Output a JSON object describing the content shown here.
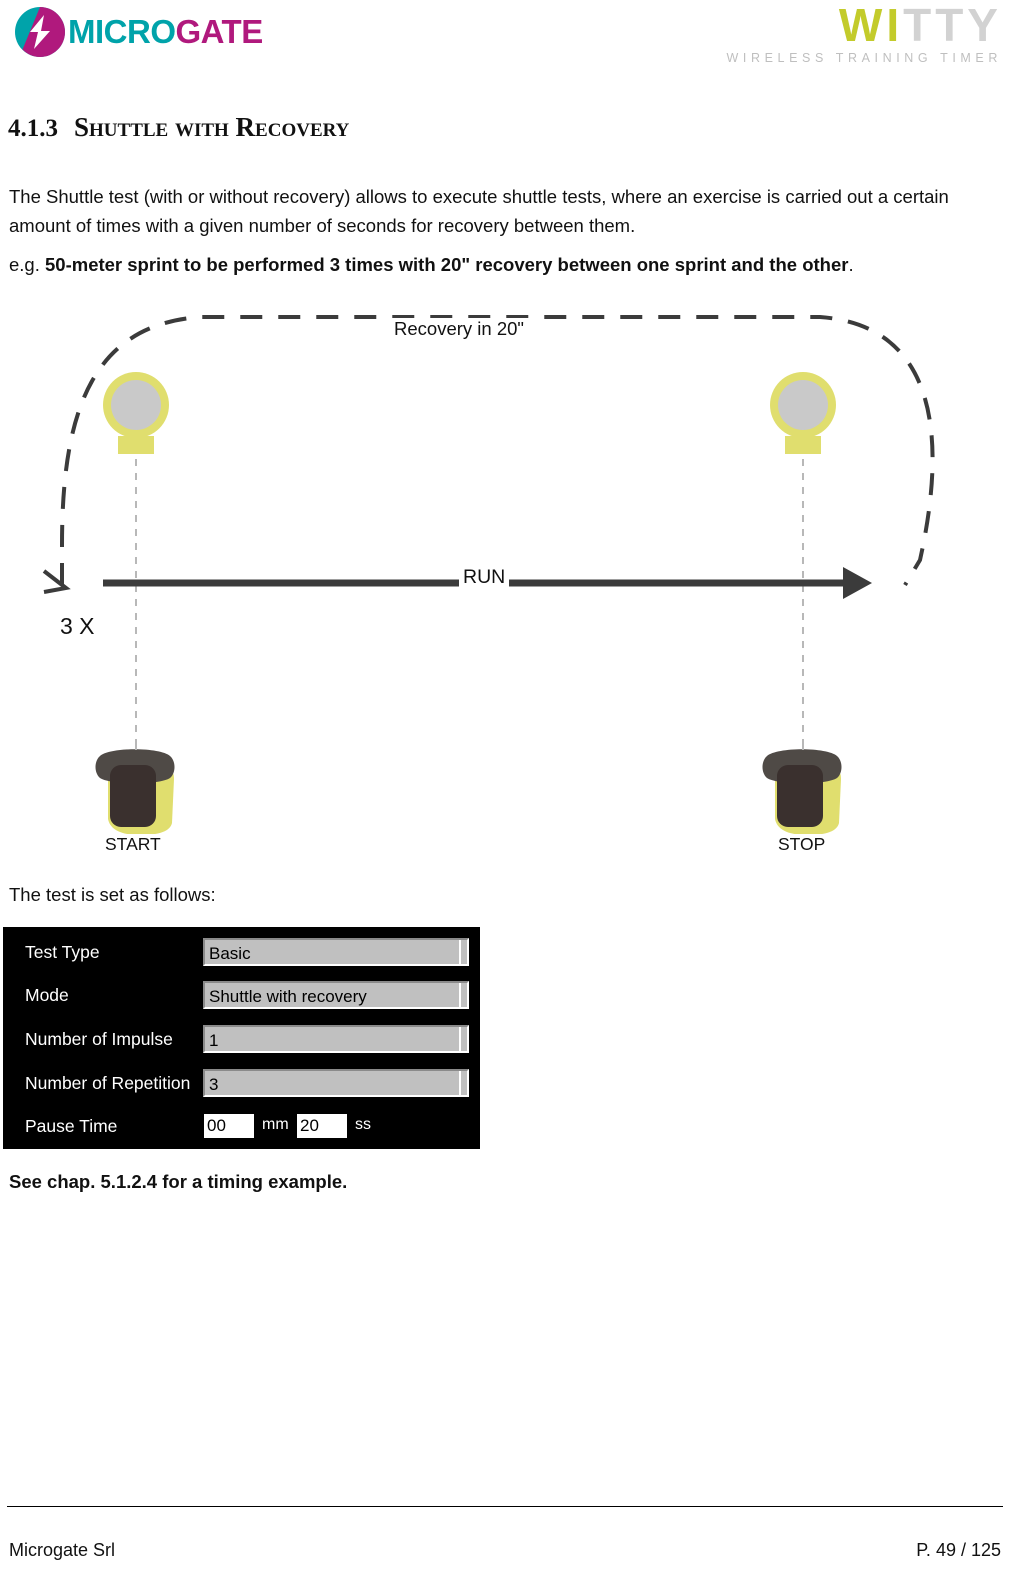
{
  "header": {
    "microgate_logo": {
      "text_part1": "MICRO",
      "text_part2": "GATE",
      "color_teal": "#00A3AA",
      "color_magenta": "#B0197D"
    },
    "witty_logo": {
      "text_part1": "WI",
      "text_part2": "TTY",
      "subtitle": "WIRELESS TRAINING TIMER",
      "color_yellow": "#C3CB2B",
      "color_gray": "#D2D2D2"
    }
  },
  "heading": {
    "number": "4.1.3",
    "title": "Shuttle with Recovery"
  },
  "body": {
    "intro": "The Shuttle test (with or without recovery) allows to execute shuttle tests, where an exercise is carried out a certain amount of times with a given number of seconds for recovery between them.",
    "example_prefix": "e.g. ",
    "example_bold": "50-meter sprint to be performed 3 times with 20\" recovery between one sprint and the other",
    "example_suffix": ".",
    "follows": "The test is set as follows:",
    "see_chapter": "See chap. 5.1.2.4 for a timing example."
  },
  "diagram": {
    "recovery_label": "Recovery in 20\"",
    "run_label": "RUN",
    "repetitions_label": "3 X",
    "start_label": "START",
    "stop_label": "STOP",
    "colors": {
      "device_yellow": "#E0DE6E",
      "device_dark": "#3A302E",
      "device_cap": "#4F4A46",
      "line_dark": "#3B3B3B"
    }
  },
  "settings_panel": {
    "background": "#000000",
    "rows": [
      {
        "label": "Test Type",
        "type": "combo",
        "value": "Basic"
      },
      {
        "label": "Mode",
        "type": "combo",
        "value": "Shuttle with recovery"
      },
      {
        "label": "Number of Impulse",
        "type": "combo",
        "value": "1"
      },
      {
        "label": "Number of Repetition",
        "type": "combo",
        "value": "3"
      }
    ],
    "pause_time": {
      "label": "Pause Time",
      "minutes_value": "00",
      "minutes_unit": "mm",
      "seconds_value": "20",
      "seconds_unit": "ss"
    }
  },
  "footer": {
    "company": "Microgate Srl",
    "page": "P. 49 / 125"
  }
}
